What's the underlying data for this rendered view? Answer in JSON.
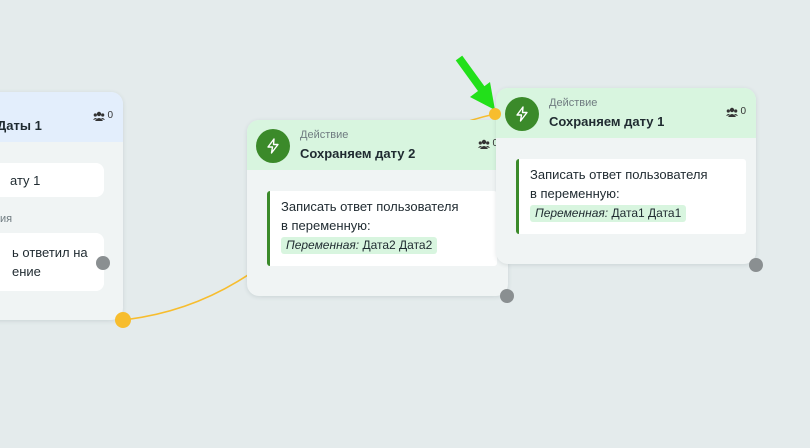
{
  "nodes": {
    "partial": {
      "title": "Даты 1",
      "counter": "0",
      "option1": "ату 1",
      "section_label": "ия",
      "option2_line1": "ь ответил на",
      "option2_line2": "ение"
    },
    "middle": {
      "type": "Действие",
      "title": "Сохраняем дату 2",
      "counter": "0",
      "action_line1": "Записать ответ пользователя",
      "action_line2": "в переменную:",
      "var_label": "Переменная:",
      "var_value": "Дата2 Дата2"
    },
    "right": {
      "type": "Действие",
      "title": "Сохраняем дату 1",
      "counter": "0",
      "action_line1": "Записать ответ пользователя",
      "action_line2": "в переменную:",
      "var_label": "Переменная:",
      "var_value": "Дата1 Дата1"
    }
  },
  "icons": {
    "action": "lightning-bolt-icon",
    "counter": "users-icon",
    "pointer": "green-arrow-icon"
  },
  "colors": {
    "canvas": "#e4ebec",
    "header_green": "#d8f5df",
    "header_blue": "#e3eefc",
    "accent_green": "#3b8a2a",
    "connector_yellow": "#f7bd2e",
    "port_gray": "#8a8f91",
    "pointer_green": "#22e01a"
  }
}
